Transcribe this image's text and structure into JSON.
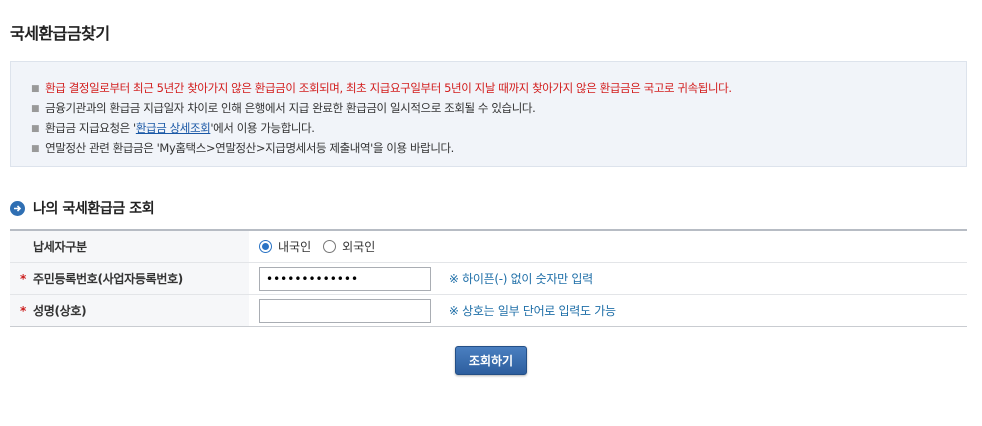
{
  "page": {
    "title": "국세환급금찾기"
  },
  "notice": {
    "item1": "환급 결정일로부터 최근 5년간 찾아가지 않은 환급금이 조회되며, 최초 지급요구일부터 5년이 지날 때까지 찾아가지 않은 환급금은 국고로 귀속됩니다.",
    "item2": "금융기관과의 환급금 지급일자 차이로 인해 은행에서 지급 완료한 환급금이 일시적으로 조회될 수 있습니다.",
    "item3_prefix": "환급금 지급요청은 '",
    "item3_link": "환급금 상세조회",
    "item3_suffix": "'에서 이용 가능합니다.",
    "item4": "연말정산 관련 환급금은 'My홈택스>연말정산>지급명세서등 제출내역'을 이용 바랍니다.",
    "bullet": "■",
    "highlight_color": "#d21d1d"
  },
  "section": {
    "title": "나의 국세환급금 조회",
    "icon": "arrow-right-circle-icon"
  },
  "form": {
    "taxpayer_type": {
      "label": "납세자구분",
      "options": [
        {
          "label": "내국인",
          "checked": true
        },
        {
          "label": "외국인",
          "checked": false
        }
      ]
    },
    "id_number": {
      "required_mark": "*",
      "label": "주민등록번호(사업자등록번호)",
      "value": "•••••••••••••",
      "hint": "※ 하이픈(-) 없이 숫자만 입력"
    },
    "name": {
      "required_mark": "*",
      "label": "성명(상호)",
      "value": "",
      "hint": "※ 상호는 일부 단어로 입력도 가능"
    }
  },
  "submit": {
    "label": "조회하기",
    "color": "#2d5e9e"
  }
}
